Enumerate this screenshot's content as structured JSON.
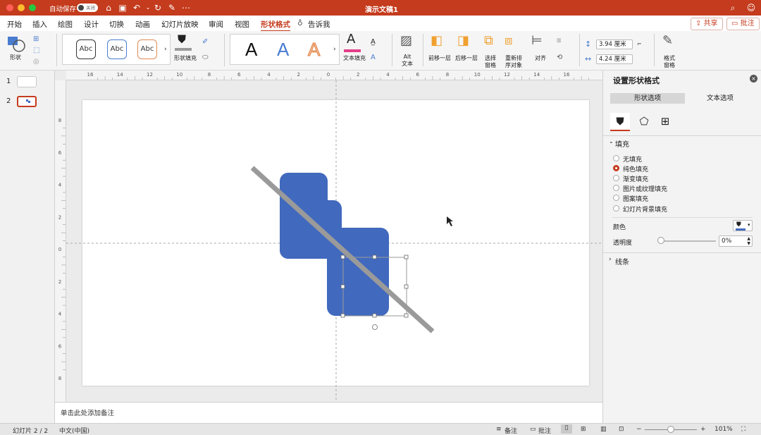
{
  "window": {
    "title": "演示文稿1",
    "autosave_label": "自动保存",
    "autosave_state": "关闭"
  },
  "menu": {
    "tabs": [
      "开始",
      "插入",
      "绘图",
      "设计",
      "切换",
      "动画",
      "幻灯片放映",
      "审阅",
      "视图",
      "形状格式"
    ],
    "active_tab": "形状格式",
    "tell_me": "告诉我",
    "share_label": "共享",
    "comment_label": "批注"
  },
  "ribbon": {
    "shape_label": "形状",
    "style_samples": [
      "Abc",
      "Abc",
      "Abc"
    ],
    "shape_fill_label": "形状填充",
    "wordart_samples": [
      "A",
      "A",
      "A"
    ],
    "text_fill_label": "文本填充",
    "alt_text_label": "Alt 文本",
    "bring_forward_label": "前移一层",
    "send_backward_label": "后移一层",
    "selection_pane_label": "选择 窗格",
    "reorder_label": "重新排 序对象",
    "align_label": "对齐",
    "height_value": "3.94 厘米",
    "width_value": "4.24 厘米",
    "format_pane_label": "格式 窗格"
  },
  "ruler": {
    "h_ticks": [
      "16",
      "14",
      "12",
      "10",
      "8",
      "6",
      "4",
      "2",
      "0",
      "2",
      "4",
      "6",
      "8",
      "10",
      "12",
      "14",
      "16"
    ],
    "v_ticks": [
      "8",
      "6",
      "4",
      "2",
      "0",
      "2",
      "4",
      "6",
      "8"
    ]
  },
  "slides_panel": {
    "numbers": [
      "1",
      "2"
    ],
    "selected": "2"
  },
  "notes": {
    "placeholder": "单击此处添加备注"
  },
  "format_pane": {
    "title": "设置形状格式",
    "tabs": [
      "形状选项",
      "文本选项"
    ],
    "icons": [
      "paint-bucket-icon",
      "pentagon-icon",
      "size-layout-icon"
    ],
    "fill_section": "填充",
    "fill_options": [
      "无填充",
      "纯色填充",
      "渐变填充",
      "图片或纹理填充",
      "图案填充",
      "幻灯片背景填充"
    ],
    "selected_fill": "纯色填充",
    "color_label": "颜色",
    "transparency_label": "透明度",
    "transparency_value": "0%",
    "line_section": "线条"
  },
  "status": {
    "slide_indicator": "幻灯片 2 / 2",
    "language": "中文(中国)",
    "notes_label": "备注",
    "comments_label": "批注",
    "zoom": "101%"
  },
  "colors": {
    "accent": "#c43b1d",
    "shape_fill": "#4169be",
    "line_gray": "#9a9a9a"
  }
}
